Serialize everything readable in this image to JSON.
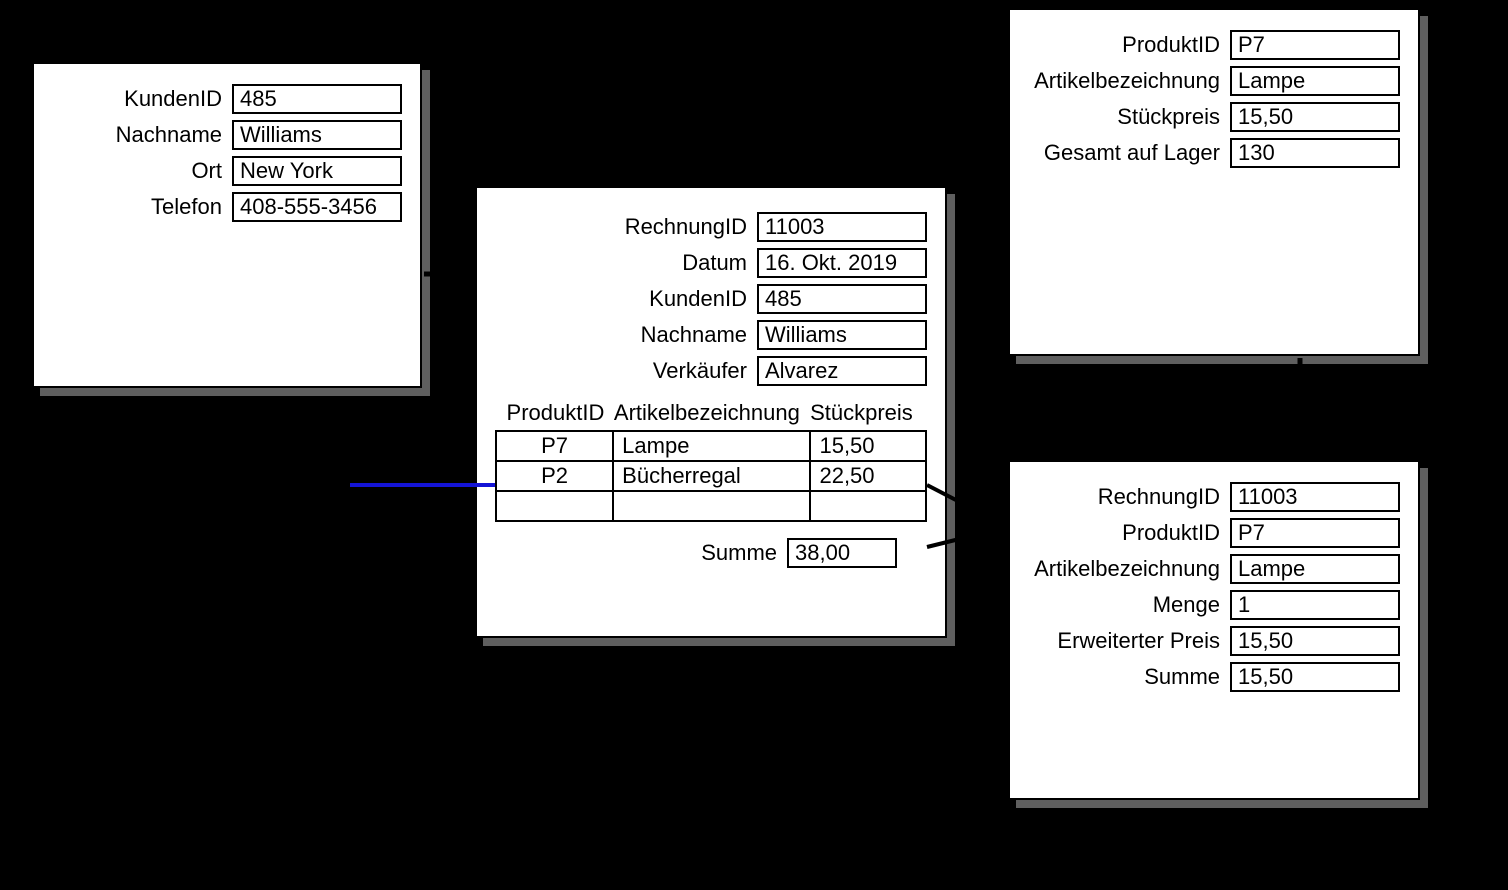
{
  "customers": {
    "labels": {
      "id": "KundenID",
      "lastname": "Nachname",
      "city": "Ort",
      "phone": "Telefon"
    },
    "id": "485",
    "lastname": "Williams",
    "city": "New York",
    "phone": "408-555-3456"
  },
  "invoices": {
    "labels": {
      "id": "RechnungID",
      "date": "Datum",
      "custid": "KundenID",
      "lastname": "Nachname",
      "sales": "Verkäufer",
      "sum": "Summe"
    },
    "id": "11003",
    "date": "16. Okt. 2019",
    "custid": "485",
    "lastname": "Williams",
    "sales": "Alvarez",
    "sum": "38,00",
    "portal": {
      "headers": {
        "prodid": "ProduktID",
        "name": "Artikelbezeichnung",
        "price": "Stückpreis"
      },
      "rows": [
        {
          "prodid": "P7",
          "name": "Lampe",
          "price": "15,50"
        },
        {
          "prodid": "P2",
          "name": "Bücherregal",
          "price": "22,50"
        },
        {
          "prodid": "",
          "name": "",
          "price": ""
        }
      ]
    }
  },
  "products": {
    "labels": {
      "id": "ProduktID",
      "name": "Artikelbezeichnung",
      "price": "Stückpreis",
      "stock": "Gesamt auf Lager"
    },
    "id": "P7",
    "name": "Lampe",
    "price": "15,50",
    "stock": "130"
  },
  "lineitems": {
    "labels": {
      "invid": "RechnungID",
      "prodid": "ProduktID",
      "name": "Artikelbezeichnung",
      "qty": "Menge",
      "ext": "Erweiterter Preis",
      "sum": "Summe"
    },
    "invid": "11003",
    "prodid": "P7",
    "name": "Lampe",
    "qty": "1",
    "ext": "15,50",
    "sum": "15,50"
  }
}
